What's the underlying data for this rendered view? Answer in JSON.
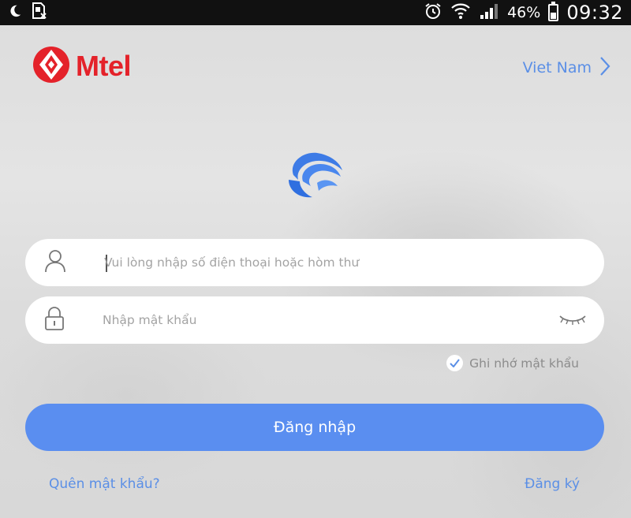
{
  "status_bar": {
    "battery_percent": "46%",
    "time": "09:32",
    "icons": [
      "moon-icon",
      "sim-card-icon",
      "alarm-icon",
      "wifi-icon",
      "signal-icon",
      "battery-icon"
    ]
  },
  "header": {
    "brand": "Mtel",
    "region_label": "Viet Nam",
    "region_icon": "chevron-right-icon"
  },
  "login_form": {
    "username_placeholder": "Vui lòng nhập số điện thoại hoặc hòm thư",
    "username_value": "",
    "password_placeholder": "Nhập mật khẩu",
    "password_value": "",
    "remember_label": "Ghi nhớ mật khẩu",
    "remember_checked": true,
    "login_button": "Đăng nhập",
    "forgot_link": "Quên mật khẩu?",
    "register_link": "Đăng ký"
  },
  "colors": {
    "brand_red": "#e4222a",
    "accent_blue": "#5a8ef0",
    "link_blue": "#5b8fe6"
  }
}
